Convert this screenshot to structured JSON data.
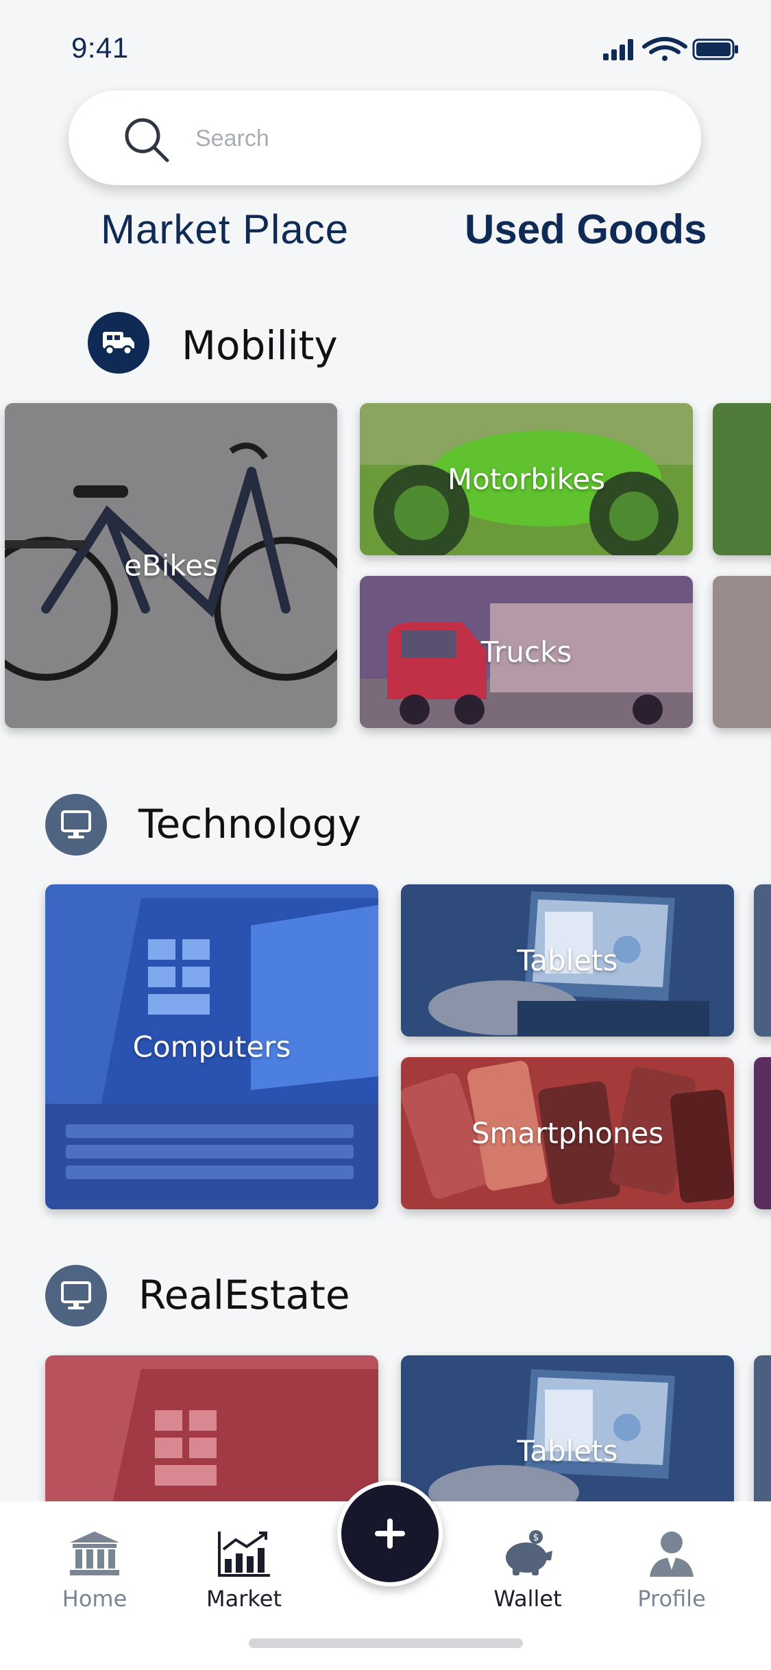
{
  "status": {
    "time": "9:41"
  },
  "search": {
    "placeholder": "Search"
  },
  "tabs": {
    "market_place": "Market Place",
    "used_goods": "Used Goods"
  },
  "sections": {
    "mobility": {
      "title": "Mobility",
      "icon": "truck-icon",
      "color": "#0f2a55"
    },
    "technology": {
      "title": "Technology",
      "icon": "monitor-icon",
      "color": "#4f6481"
    },
    "realestate": {
      "title": "RealEstate",
      "icon": "monitor-icon",
      "color": "#4f6481"
    }
  },
  "cards": {
    "ebikes": "eBikes",
    "motorbikes": "Motorbikes",
    "trucks": "Trucks",
    "computers": "Computers",
    "tablets": "Tablets",
    "smartphones": "Smartphones",
    "realestate_tablets": "Tablets"
  },
  "nav": {
    "home": "Home",
    "market": "Market",
    "wallet": "Wallet",
    "profile": "Profile",
    "add_icon": "plus-icon"
  },
  "colors": {
    "primary": "#0f2a55",
    "nav_inactive": "#7a8593",
    "fab": "#16172b"
  }
}
